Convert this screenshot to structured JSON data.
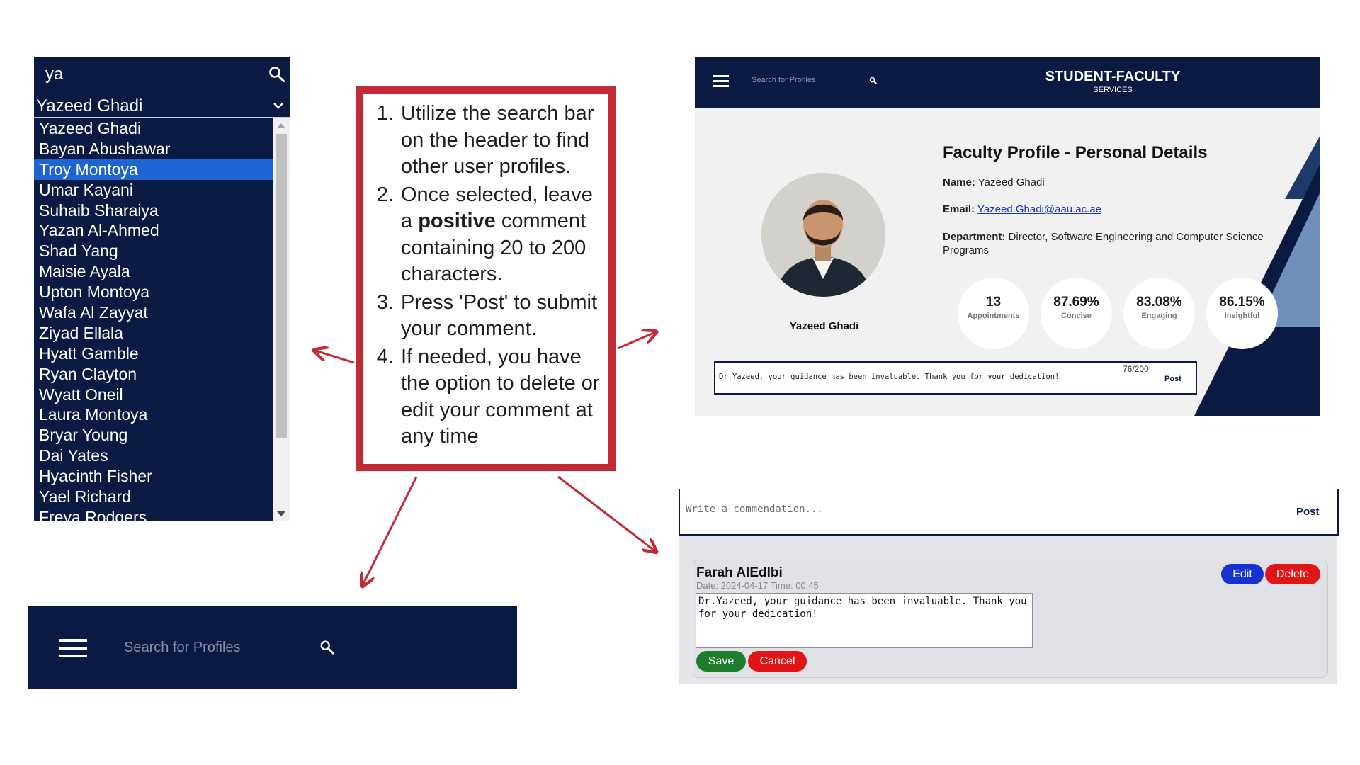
{
  "search_panel": {
    "query": "ya",
    "selected_value": "Yazeed Ghadi",
    "options": [
      "Yazeed Ghadi",
      "Bayan Abushawar",
      "Troy Montoya",
      "Umar Kayani",
      "Suhaib Sharaiya",
      "Yazan Al-Ahmed",
      "Shad Yang",
      "Maisie Ayala",
      "Upton Montoya",
      "Wafa Al Zayyat",
      "Ziyad Ellala",
      "Hyatt Gamble",
      "Ryan Clayton",
      "Wyatt Oneil",
      "Laura Montoya",
      "Bryar Young",
      "Dai Yates",
      "Hyacinth Fisher",
      "Yael Richard",
      "Freya Rodgers"
    ],
    "highlighted_option": "Troy Montoya"
  },
  "instructions": {
    "step1": "Utilize the search bar on the header to find other user profiles.",
    "step2_pre": "Once selected, leave a ",
    "step2_bold": "positive",
    "step2_post": " comment containing 20 to 200 characters.",
    "step3": "Press 'Post' to submit your comment.",
    "step4": "If needed, you have the option to delete or edit your comment at any time"
  },
  "profile": {
    "header": {
      "search_placeholder": "Search for Profiles",
      "brand_title": "STUDENT-FACULTY",
      "brand_subtitle": "SERVICES"
    },
    "page_title": "Faculty Profile - Personal Details",
    "name_label": "Name:",
    "name": "Yazeed Ghadi",
    "email_label": "Email:",
    "email": "Yazeed.Ghadi@aau.ac.ae",
    "department_label": "Department:",
    "department": "Director, Software Engineering and Computer Science Programs",
    "avatar_name": "Yazeed Ghadi",
    "stats": [
      {
        "value": "13",
        "label": "Appointments"
      },
      {
        "value": "87.69%",
        "label": "Concise"
      },
      {
        "value": "83.08%",
        "label": "Engaging"
      },
      {
        "value": "86.15%",
        "label": "Insightful"
      }
    ],
    "comment_text": "Dr.Yazeed, your guidance has been invaluable. Thank you for your dedication!",
    "char_count": "76/200",
    "post_label": "Post"
  },
  "header_zoom": {
    "search_placeholder": "Search for Profiles"
  },
  "comment_panel": {
    "placeholder": "Write a commendation...",
    "post_label": "Post",
    "author": "Farah AlEdlbi",
    "date_line": "Date: 2024-04-17 Time: 00:45",
    "text": "Dr.Yazeed, your guidance has been invaluable. Thank you for your dedication!",
    "edit_label": "Edit",
    "delete_label": "Delete",
    "save_label": "Save",
    "cancel_label": "Cancel"
  },
  "colors": {
    "navy": "#0b1a42",
    "highlight": "#1e64d2",
    "callout_border": "#c22a36",
    "edit_blue": "#1433d0",
    "delete_red": "#e01616",
    "save_green": "#1d7d2c"
  },
  "icons": [
    "search-icon",
    "chevron-down-icon",
    "hamburger-menu-icon",
    "arrow-icon"
  ]
}
